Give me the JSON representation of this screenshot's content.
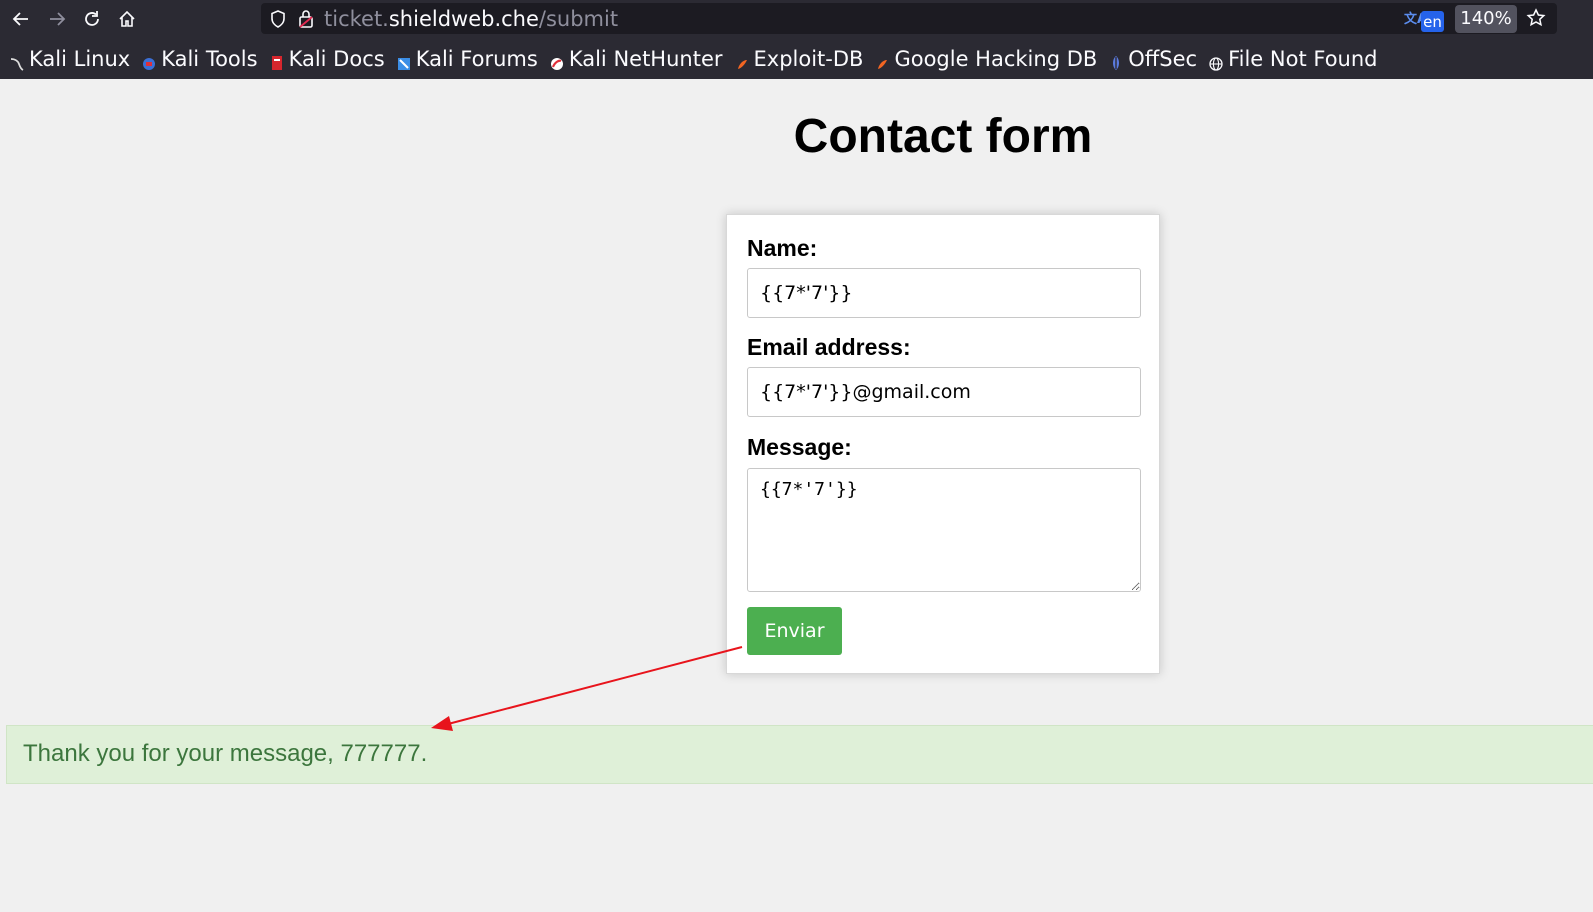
{
  "browser": {
    "url": {
      "prefix": "ticket.",
      "host": "shieldweb.che",
      "path": "/submit"
    },
    "translate_label": "en",
    "zoom": "140%",
    "icons": {
      "back": "back-arrow-icon",
      "forward": "forward-arrow-icon",
      "reload": "reload-icon",
      "home": "home-icon",
      "shield": "tracking-shield-icon",
      "lock": "lock-icon",
      "translate": "translate-icon",
      "star": "bookmark-star-icon"
    },
    "bookmarks": [
      {
        "label": "Kali Linux",
        "icon": "kali-dragon-icon",
        "color": "#dddddd"
      },
      {
        "label": "Kali Tools",
        "icon": "kali-tools-icon",
        "color": "#3b6fd6"
      },
      {
        "label": "Kali Docs",
        "icon": "kali-docs-icon",
        "color": "#d7262e"
      },
      {
        "label": "Kali Forums",
        "icon": "kali-forums-icon",
        "color": "#3b8ee6"
      },
      {
        "label": "Kali NetHunter",
        "icon": "nethunter-icon",
        "color": "#e0303a"
      },
      {
        "label": "Exploit-DB",
        "icon": "exploit-db-icon",
        "color": "#f26522"
      },
      {
        "label": "Google Hacking DB",
        "icon": "ghdb-icon",
        "color": "#f26522"
      },
      {
        "label": "OffSec",
        "icon": "offsec-icon",
        "color": "#5b7be0"
      },
      {
        "label": "File Not Found",
        "icon": "globe-icon",
        "color": "#fbfbfe"
      }
    ]
  },
  "page": {
    "title": "Contact form",
    "form": {
      "name_label": "Name:",
      "name_value": "{{7*'7'}}",
      "email_label": "Email address:",
      "email_value": "{{7*'7'}}@gmail.com",
      "message_label": "Message:",
      "message_value": "{{7*'7'}}",
      "submit_label": "Enviar"
    },
    "success_message": "Thank you for your message, 777777.",
    "colors": {
      "submit_button": "#4caf50",
      "success_background": "#dff0d8",
      "success_text": "#3c763d",
      "annotation_arrow": "#e8141c"
    }
  }
}
